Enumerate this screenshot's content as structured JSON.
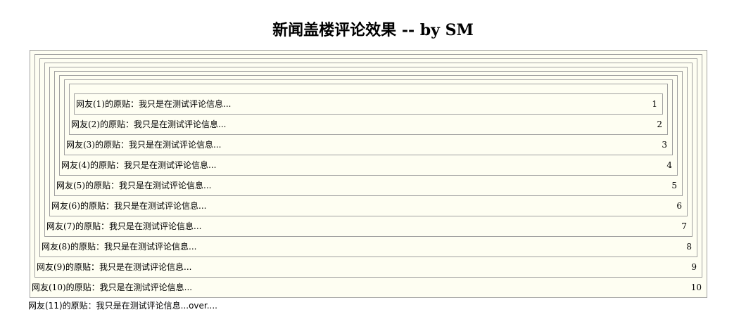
{
  "page": {
    "title": "新闻盖楼评论效果 -- by SM"
  },
  "floors": [
    {
      "author": "网友(1)的原贴：",
      "text": "我只是在测试评论信息...",
      "number": "1"
    },
    {
      "author": "网友(2)的原贴：",
      "text": "我只是在测试评论信息...",
      "number": "2"
    },
    {
      "author": "网友(3)的原贴：",
      "text": "我只是在测试评论信息...",
      "number": "3"
    },
    {
      "author": "网友(4)的原贴：",
      "text": "我只是在测试评论信息...",
      "number": "4"
    },
    {
      "author": "网友(5)的原贴：",
      "text": "我只是在测试评论信息...",
      "number": "5"
    },
    {
      "author": "网友(6)的原贴：",
      "text": "我只是在测试评论信息...",
      "number": "6"
    },
    {
      "author": "网友(7)的原贴：",
      "text": "我只是在测试评论信息...",
      "number": "7"
    },
    {
      "author": "网友(8)的原贴：",
      "text": "我只是在测试评论信息...",
      "number": "8"
    },
    {
      "author": "网友(9)的原贴：",
      "text": "我只是在测试评论信息...",
      "number": "9"
    },
    {
      "author": "网友(10)的原贴：",
      "text": "我只是在测试评论信息...",
      "number": "10"
    }
  ],
  "latest": {
    "author": "网友(11)的原贴：",
    "text": "我只是在测试评论信息...over...."
  },
  "colors": {
    "border": "#a0a0a0",
    "background": "#fefef2"
  }
}
